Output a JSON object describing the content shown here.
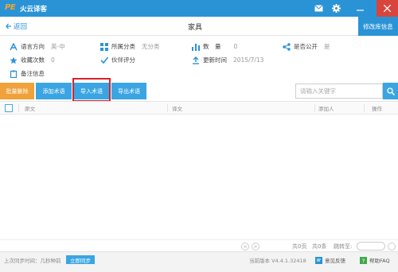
{
  "app": {
    "logo": "PE",
    "name": "火云译客"
  },
  "header": {
    "back_label": "返回",
    "title": "家具",
    "edit_button": "修改库信息"
  },
  "info": {
    "direction_label": "语言方向",
    "direction_value": "英-中",
    "category_label": "所属分类",
    "category_value": "无分类",
    "count_label": "数　量",
    "count_value": "0",
    "public_label": "是否公开",
    "public_value": "是",
    "favorites_label": "收藏次数",
    "favorites_value": "0",
    "partner_label": "伙伴评分",
    "updated_label": "更新时间",
    "updated_value": "2015/7/13",
    "notes_label": "备注信息"
  },
  "toolbar": {
    "batch_delete": "批量删除",
    "add_term": "添加术语",
    "import_term": "导入术语",
    "export_term": "导出术语",
    "search_placeholder": "请输入关键字"
  },
  "table": {
    "columns": [
      "原文",
      "译文",
      "添加人",
      "操作"
    ]
  },
  "pager": {
    "total": "共0页",
    "count": "共0条",
    "jump_label": "跳转至:",
    "prev": "<",
    "next": ">"
  },
  "status": {
    "last_sync": "上次同步时间：几秒种前",
    "sync_button": "立即同步",
    "version": "当前版本 V4.4.1.32418",
    "feedback": "意见反馈",
    "help": "帮助FAQ"
  },
  "colors": {
    "primary": "#2a93d6",
    "accent_orange": "#f0a13a",
    "button_blue": "#3aa5e2",
    "highlight": "#d8222a",
    "close": "#d8453c"
  }
}
